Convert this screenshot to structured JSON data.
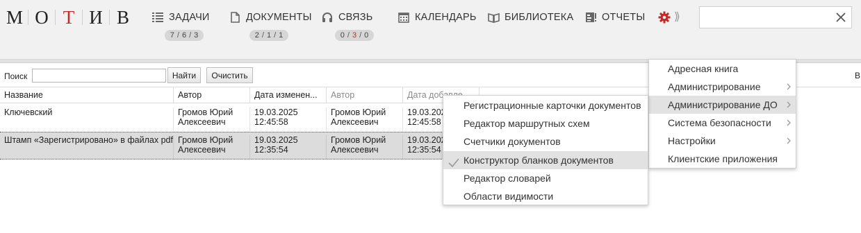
{
  "app": {
    "logo_letters": [
      "М",
      "О",
      "Т",
      "И",
      "В"
    ]
  },
  "nav": {
    "tasks": {
      "label": "ЗАДАЧИ",
      "counts": [
        "7",
        "6",
        "3"
      ],
      "icon": "list-icon"
    },
    "documents": {
      "label": "ДОКУМЕНТЫ",
      "counts": [
        "2",
        "1",
        "1"
      ],
      "icon": "document-icon"
    },
    "connect": {
      "label": "СВЯЗЬ",
      "counts": [
        "0",
        "3",
        "0"
      ],
      "icon": "headset-icon"
    },
    "calendar": {
      "label": "КАЛЕНДАРЬ",
      "icon": "calendar-icon"
    },
    "library": {
      "label": "БИБЛИОТЕКА",
      "icon": "book-icon"
    },
    "reports": {
      "label": "ОТЧЕТЫ",
      "icon": "report-icon"
    },
    "settings_icon": "gear-icon",
    "more_label": "⟫"
  },
  "top_search": {
    "value": "",
    "placeholder": ""
  },
  "search": {
    "label": "Поиск",
    "value": "",
    "find_label": "Найти",
    "clear_label": "Очистить"
  },
  "right_edge_text": "В",
  "table": {
    "columns": [
      "Название",
      "Автор",
      "Дата изменен...",
      "Автор",
      "Дата добавле..."
    ],
    "rows": [
      {
        "name": "Ключевский",
        "author": "Громов Юрий Алексеевич",
        "modified": "19.03.2025 12:45:58",
        "author2": "Громов Юрий Алексеевич",
        "added": "19.03.2025 12:45:58"
      },
      {
        "name": "Штамп «Зарегистрировано» в файлах pdf",
        "author": "Громов Юрий Алексеевич",
        "modified": "19.03.2025 12:35:54",
        "author2": "Громов Юрий Алексеевич",
        "added": "19.03.2025 12:35:54"
      }
    ]
  },
  "settings_menu": {
    "items": [
      "Адресная книга",
      "Администрирование",
      "Администрирование ДО",
      "Система безопасности",
      "Настройки",
      "Клиентские приложения"
    ]
  },
  "admin_do_menu": {
    "items": [
      "Регистрационные карточки документов",
      "Редактор маршрутных схем",
      "Счетчики документов",
      "Конструктор бланков документов",
      "Редактор словарей",
      "Области видимости"
    ]
  },
  "colors": {
    "brand_red": "#c62828",
    "topbar_bg": "#f1f1f1",
    "counter_bg": "#d6d6d6",
    "selected_row": "#dcdcdc",
    "menu_active": "#e2e2e2"
  }
}
